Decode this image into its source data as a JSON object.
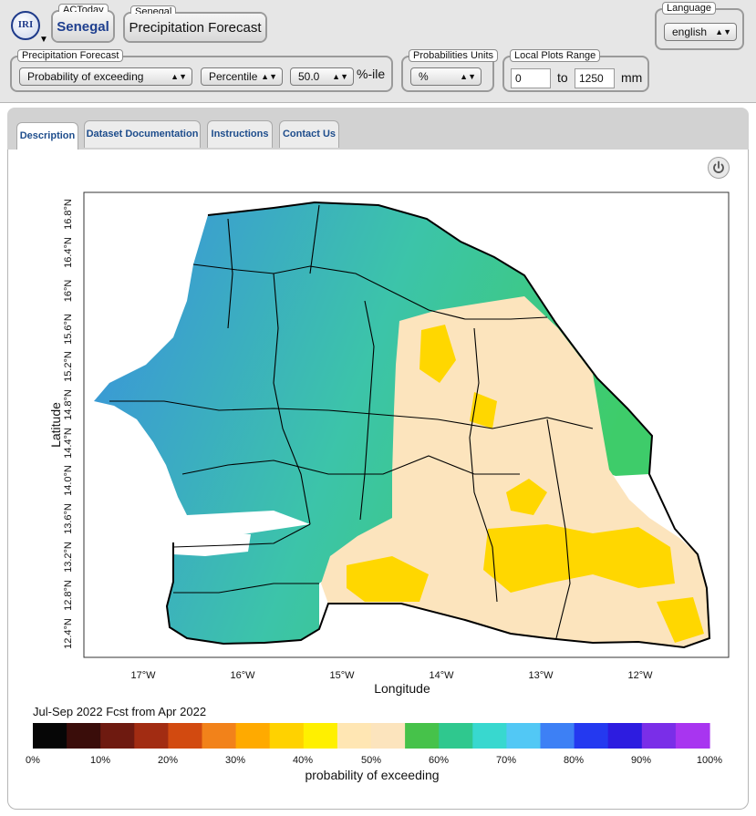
{
  "header": {
    "logo_text": "IRI",
    "actoday": {
      "label": "ACToday",
      "value": "Senegal"
    },
    "region": {
      "label": "Senegal",
      "value": "Precipitation Forecast"
    },
    "language": {
      "label": "Language",
      "value": "english"
    },
    "forecast": {
      "label": "Precipitation Forecast",
      "type_value": "Probability of exceeding",
      "mode_value": "Percentile",
      "percentile_value": "50.0",
      "unit_suffix": "%-ile"
    },
    "units": {
      "label": "Probabilities Units",
      "value": "%"
    },
    "range": {
      "label": "Local Plots Range",
      "min": "0",
      "to_label": "to",
      "max": "1250",
      "unit": "mm"
    }
  },
  "tabs": [
    {
      "label": "Description",
      "active": true
    },
    {
      "label": "Dataset Documentation",
      "active": false
    },
    {
      "label": "Instructions",
      "active": false
    },
    {
      "label": "Contact Us",
      "active": false
    }
  ],
  "map": {
    "y_axis_title": "Latitude",
    "x_axis_title": "Longitude",
    "lat_ticks": [
      "12.4°N",
      "12.8°N",
      "13.2°N",
      "13.6°N",
      "14.0°N",
      "14.4°N",
      "14.8°N",
      "15.2°N",
      "15.6°N",
      "16°N",
      "16.4°N",
      "16.8°N"
    ],
    "lon_ticks": [
      "17°W",
      "16°W",
      "15°W",
      "14°W",
      "13°W",
      "12°W"
    ],
    "caption": "Jul-Sep 2022 Fcst from Apr 2022",
    "colorbar_title": "probability of exceeding",
    "colorbar_ticks": [
      "0%",
      "10%",
      "20%",
      "30%",
      "40%",
      "50%",
      "60%",
      "70%",
      "80%",
      "90%",
      "100%"
    ],
    "colorbar_colors": [
      "#060606",
      "#3a0d0a",
      "#6e1a10",
      "#a22c12",
      "#d24a10",
      "#f2821a",
      "#ffaa00",
      "#ffd200",
      "#fff000",
      "#ffe6b3",
      "#fce4bd",
      "#46c24a",
      "#2fc88e",
      "#38d8cf",
      "#52c8f5",
      "#3d80f5",
      "#2439f0",
      "#2d1ce0",
      "#7a2ee8",
      "#a835f0"
    ],
    "colors": {
      "dry_deep": "#ffd700",
      "dry": "#fce4bd",
      "wet_light": "#3ecc6a",
      "wet": "#3cc4a9",
      "wet_strong": "#3a8fe0"
    }
  }
}
